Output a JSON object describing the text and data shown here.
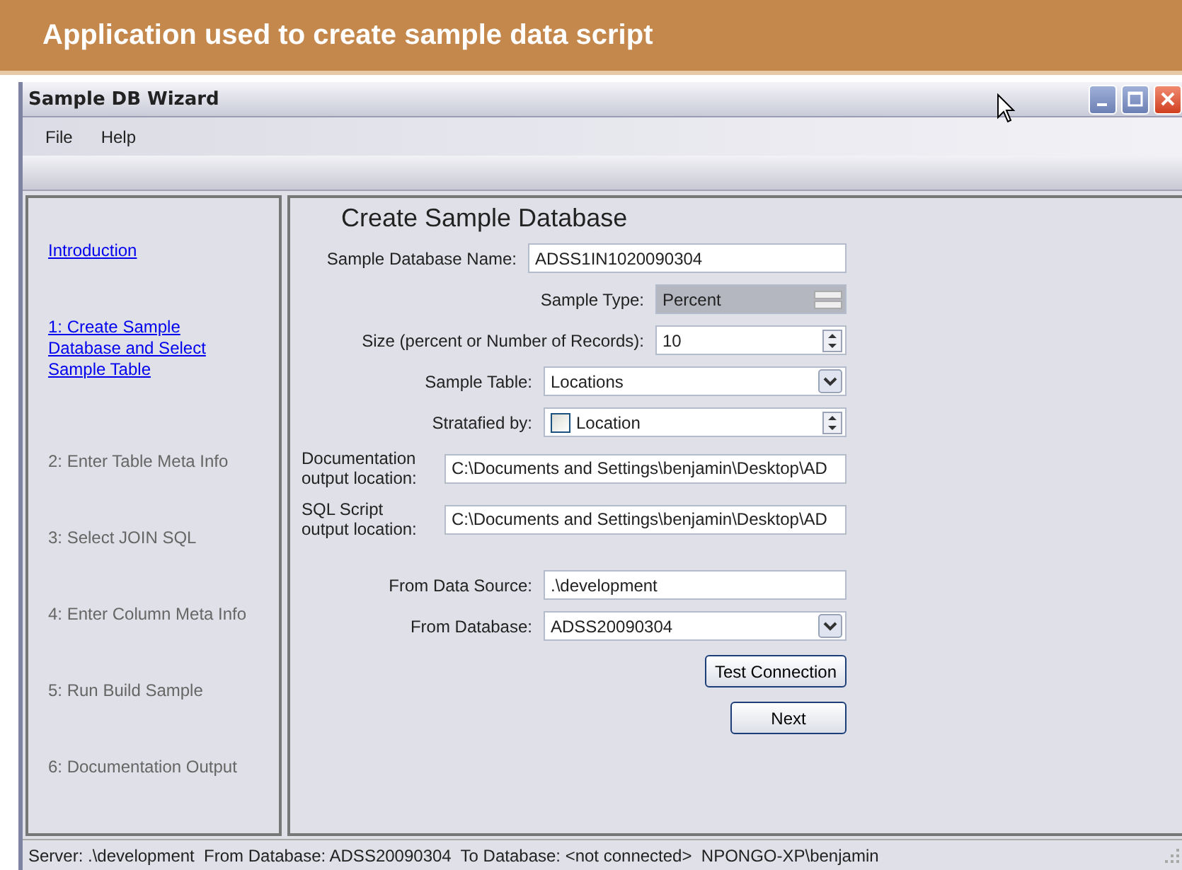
{
  "banner": {
    "title": "Application used to create sample data script"
  },
  "window": {
    "title": "Sample DB Wizard"
  },
  "menu": [
    "File",
    "Help"
  ],
  "steps": [
    {
      "label": "Introduction",
      "disabled": false
    },
    {
      "label": "1: Create Sample Database and Select Sample Table",
      "disabled": false
    },
    {
      "label": "2: Enter Table Meta Info",
      "disabled": true
    },
    {
      "label": "3: Select JOIN SQL",
      "disabled": true
    },
    {
      "label": "4: Enter Column Meta Info",
      "disabled": true
    },
    {
      "label": "5: Run Build Sample",
      "disabled": true
    },
    {
      "label": "6: Documentation Output",
      "disabled": true
    }
  ],
  "form": {
    "title": "Create Sample Database",
    "fields": [
      {
        "kind": "text",
        "label": "Sample Database Name:",
        "value": "ADSS1IN1020090304"
      },
      {
        "kind": "type",
        "label": "Sample Type:",
        "value": "Percent"
      },
      {
        "kind": "spin",
        "label": "Size (percent or Number of Records):",
        "value": "10"
      },
      {
        "kind": "dropdown",
        "label": "Sample Table:",
        "value": "Locations"
      },
      {
        "kind": "check",
        "label": "Stratafied by:",
        "value": "Location",
        "checked": false
      },
      {
        "kind": "path",
        "label": "Documentation output location:",
        "value": "C:\\Documents and Settings\\benjamin\\Desktop\\AD"
      },
      {
        "kind": "path",
        "label": "SQL Script output location:",
        "value": "C:\\Documents and Settings\\benjamin\\Desktop\\AD"
      },
      {
        "kind": "text",
        "label": "From Data Source:",
        "value": ".\\development"
      },
      {
        "kind": "dropdown",
        "label": "From Database:",
        "value": "ADSS20090304"
      }
    ],
    "buttons": [
      "Test Connection",
      "Next"
    ]
  },
  "status_bar": "Server: .\\development  From Database: ADSS20090304  To Database: <not connected>  NPONGO-XP\\benjamin"
}
